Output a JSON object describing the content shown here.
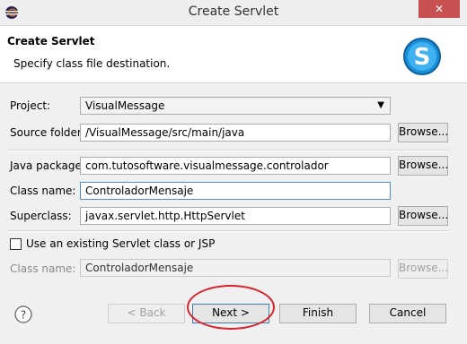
{
  "window": {
    "title": "Create Servlet",
    "close_label": "✕"
  },
  "banner": {
    "title": "Create Servlet",
    "description": "Specify class file destination."
  },
  "form": {
    "project_label": "Project:",
    "project_value": "VisualMessage",
    "source_folder_label": "Source folder:",
    "source_folder_value": "/VisualMessage/src/main/java",
    "java_package_label": "Java package:",
    "java_package_value": "com.tutosoftware.visualmessage.controlador",
    "class_name_label": "Class name:",
    "class_name_value": "ControladorMensaje",
    "superclass_label": "Superclass:",
    "superclass_value": "javax.servlet.http.HttpServlet",
    "browse_label": "Browse...",
    "existing_checkbox_label": "Use an existing Servlet class or JSP",
    "existing_checked": false,
    "class_name2_label": "Class name:",
    "class_name2_value": "ControladorMensaje"
  },
  "buttons": {
    "back": "< Back",
    "next": "Next >",
    "finish": "Finish",
    "cancel": "Cancel"
  },
  "colors": {
    "annotation": "#d8232a",
    "close": "#c75050",
    "icon_blue": "#1a8fd8"
  },
  "icons": {
    "app": "eclipse-icon",
    "banner": "servlet-s-icon",
    "help": "help-icon"
  }
}
